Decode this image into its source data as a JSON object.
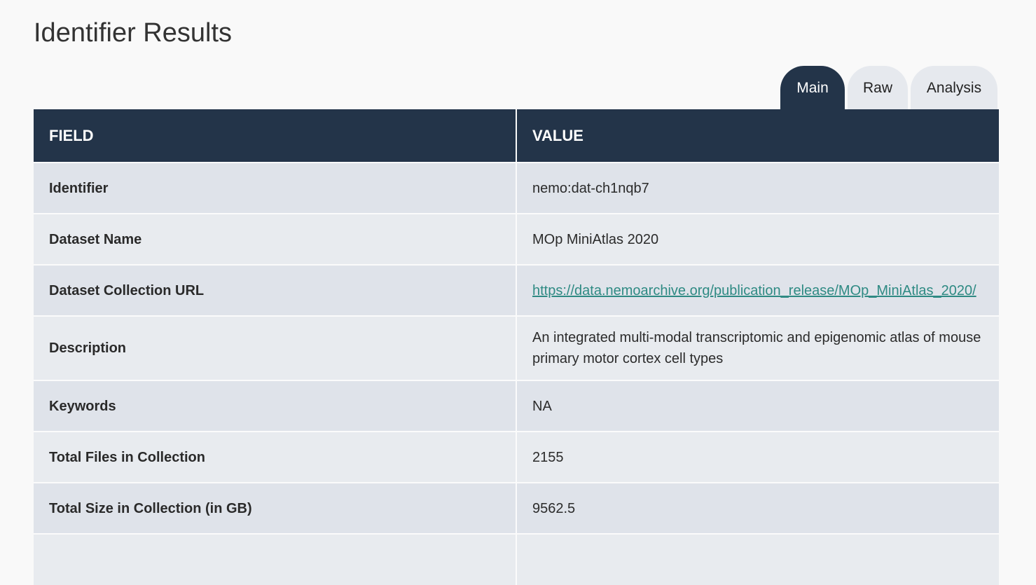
{
  "page": {
    "title": "Identifier Results"
  },
  "tabs": [
    {
      "label": "Main",
      "active": true
    },
    {
      "label": "Raw",
      "active": false
    },
    {
      "label": "Analysis",
      "active": false
    }
  ],
  "table": {
    "headers": {
      "field": "FIELD",
      "value": "VALUE"
    },
    "rows": [
      {
        "field": "Identifier",
        "value": "nemo:dat-ch1nqb7"
      },
      {
        "field": "Dataset Name",
        "value": "MOp MiniAtlas 2020"
      },
      {
        "field": "Dataset Collection URL",
        "value": "https://data.nemoarchive.org/publication_release/MOp_MiniAtlas_2020/"
      },
      {
        "field": "Description",
        "value": "An integrated multi-modal transcriptomic and epigenomic atlas of mouse primary motor cortex cell types"
      },
      {
        "field": "Keywords",
        "value": "NA"
      },
      {
        "field": "Total Files in Collection",
        "value": "2155"
      },
      {
        "field": "Total Size in Collection (in GB)",
        "value": "9562.5"
      }
    ]
  },
  "colors": {
    "header_bg": "#233449",
    "row_odd": "#dfe3ea",
    "row_even": "#e8ebef",
    "link": "#2e8a83",
    "inactive_tab": "#e6e9ee"
  }
}
